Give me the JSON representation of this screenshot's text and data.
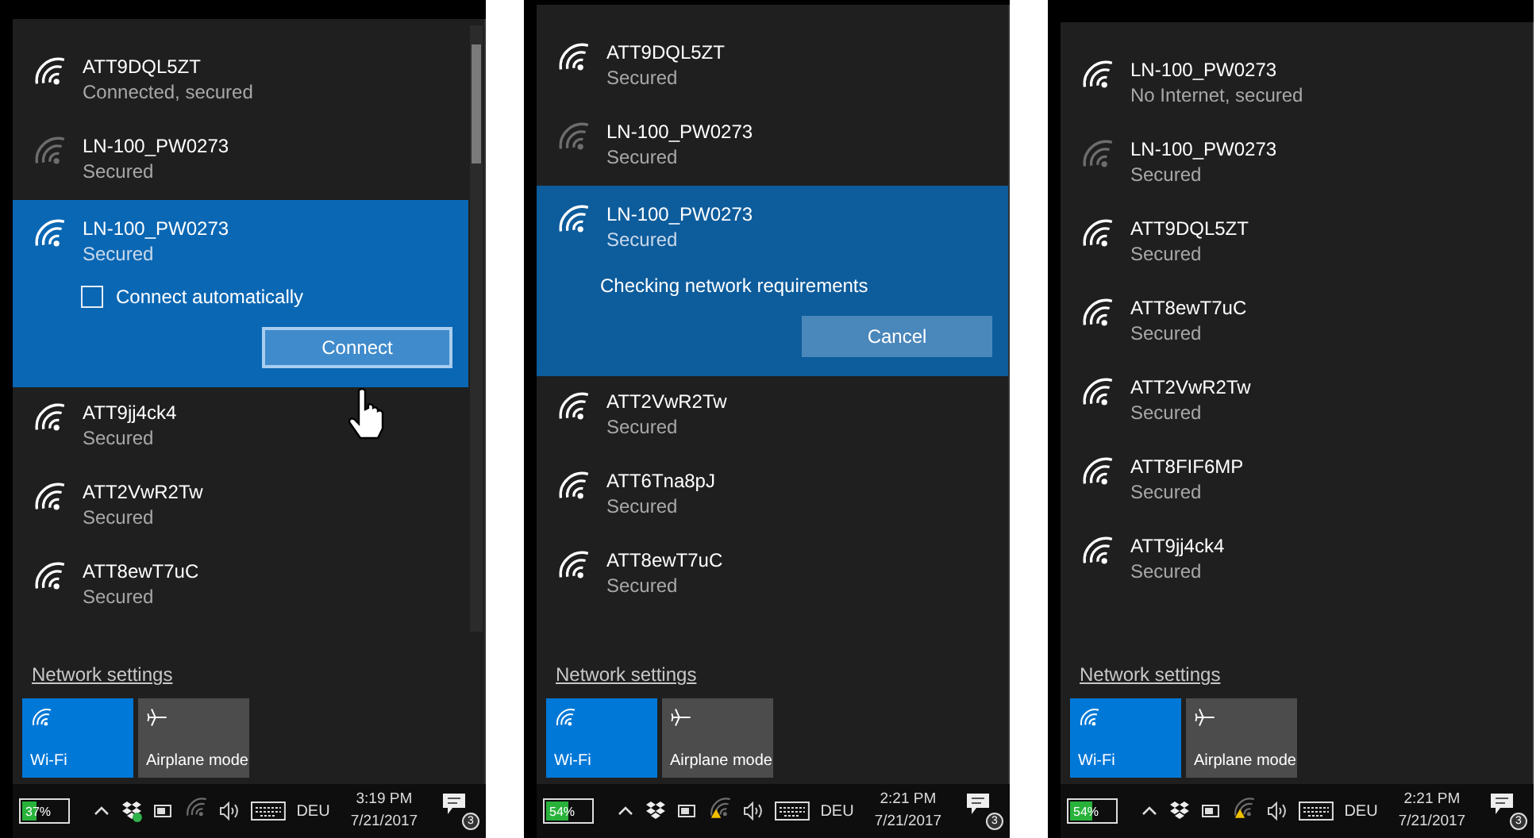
{
  "panels": [
    {
      "scrollbar": true,
      "hand_cursor": true,
      "networks": [
        {
          "kind": "plain",
          "name": "ATT9DQL5ZT",
          "status": "Connected, secured",
          "selected": false,
          "dimmed": false
        },
        {
          "kind": "plain",
          "name": "LN-100_PW0273",
          "status": "Secured",
          "selected": false,
          "dimmed": true
        },
        {
          "kind": "connect",
          "name": "LN-100_PW0273",
          "status": "Secured",
          "selected": true,
          "dimmed": false,
          "option": {
            "label": "Connect automatically",
            "checked": false
          },
          "button": "Connect"
        },
        {
          "kind": "plain",
          "name": "ATT9jj4ck4",
          "status": "Secured",
          "selected": false,
          "dimmed": false
        },
        {
          "kind": "plain",
          "name": "ATT2VwR2Tw",
          "status": "Secured",
          "selected": false,
          "dimmed": false
        },
        {
          "kind": "plain",
          "name": "ATT8ewT7uC",
          "status": "Secured",
          "selected": false,
          "dimmed": false
        }
      ],
      "settings_link": "Network settings",
      "tiles": [
        {
          "label": "Wi-Fi",
          "kind": "wifi",
          "on": true
        },
        {
          "label": "Airplane mode",
          "kind": "airplane",
          "on": false
        }
      ],
      "taskbar": {
        "battery": {
          "label": "37%",
          "level": 0.37
        },
        "dropbox_synced": true,
        "wifi_warning": false,
        "language": "DEU",
        "time": "3:19 PM",
        "date": "7/21/2017",
        "notifications": "3"
      }
    },
    {
      "networks": [
        {
          "kind": "plain",
          "name": "ATT9DQL5ZT",
          "status": "Secured",
          "selected": false,
          "dimmed": false
        },
        {
          "kind": "plain",
          "name": "LN-100_PW0273",
          "status": "Secured",
          "selected": false,
          "dimmed": true
        },
        {
          "kind": "connecting",
          "name": "LN-100_PW0273",
          "status": "Secured",
          "selected": true,
          "dimmed": false,
          "message": "Checking network requirements",
          "button": "Cancel"
        },
        {
          "kind": "plain",
          "name": "ATT2VwR2Tw",
          "status": "Secured",
          "selected": false,
          "dimmed": false
        },
        {
          "kind": "plain",
          "name": "ATT6Tna8pJ",
          "status": "Secured",
          "selected": false,
          "dimmed": false
        },
        {
          "kind": "plain",
          "name": "ATT8ewT7uC",
          "status": "Secured",
          "selected": false,
          "dimmed": false
        }
      ],
      "settings_link": "Network settings",
      "tiles": [
        {
          "label": "Wi-Fi",
          "kind": "wifi",
          "on": true
        },
        {
          "label": "Airplane mode",
          "kind": "airplane",
          "on": false
        }
      ],
      "taskbar": {
        "battery": {
          "label": "54%",
          "level": 0.54
        },
        "dropbox_synced": false,
        "wifi_warning": true,
        "language": "DEU",
        "time": "2:21 PM",
        "date": "7/21/2017",
        "notifications": "3"
      }
    },
    {
      "networks": [
        {
          "kind": "plain",
          "name": "LN-100_PW0273",
          "status": "No Internet, secured",
          "selected": false,
          "dimmed": false
        },
        {
          "kind": "plain",
          "name": "LN-100_PW0273",
          "status": "Secured",
          "selected": false,
          "dimmed": true
        },
        {
          "kind": "plain",
          "name": "ATT9DQL5ZT",
          "status": "Secured",
          "selected": false,
          "dimmed": false
        },
        {
          "kind": "plain",
          "name": "ATT8ewT7uC",
          "status": "Secured",
          "selected": false,
          "dimmed": false
        },
        {
          "kind": "plain",
          "name": "ATT2VwR2Tw",
          "status": "Secured",
          "selected": false,
          "dimmed": false
        },
        {
          "kind": "plain",
          "name": "ATT8FIF6MP",
          "status": "Secured",
          "selected": false,
          "dimmed": false
        },
        {
          "kind": "plain",
          "name": "ATT9jj4ck4",
          "status": "Secured",
          "selected": false,
          "dimmed": false
        }
      ],
      "settings_link": "Network settings",
      "tiles": [
        {
          "label": "Wi-Fi",
          "kind": "wifi",
          "on": true
        },
        {
          "label": "Airplane mode",
          "kind": "airplane",
          "on": false
        }
      ],
      "taskbar": {
        "battery": {
          "label": "54%",
          "level": 0.54
        },
        "dropbox_synced": false,
        "wifi_warning": true,
        "language": "DEU",
        "time": "2:21 PM",
        "date": "7/21/2017",
        "notifications": "3"
      }
    }
  ]
}
